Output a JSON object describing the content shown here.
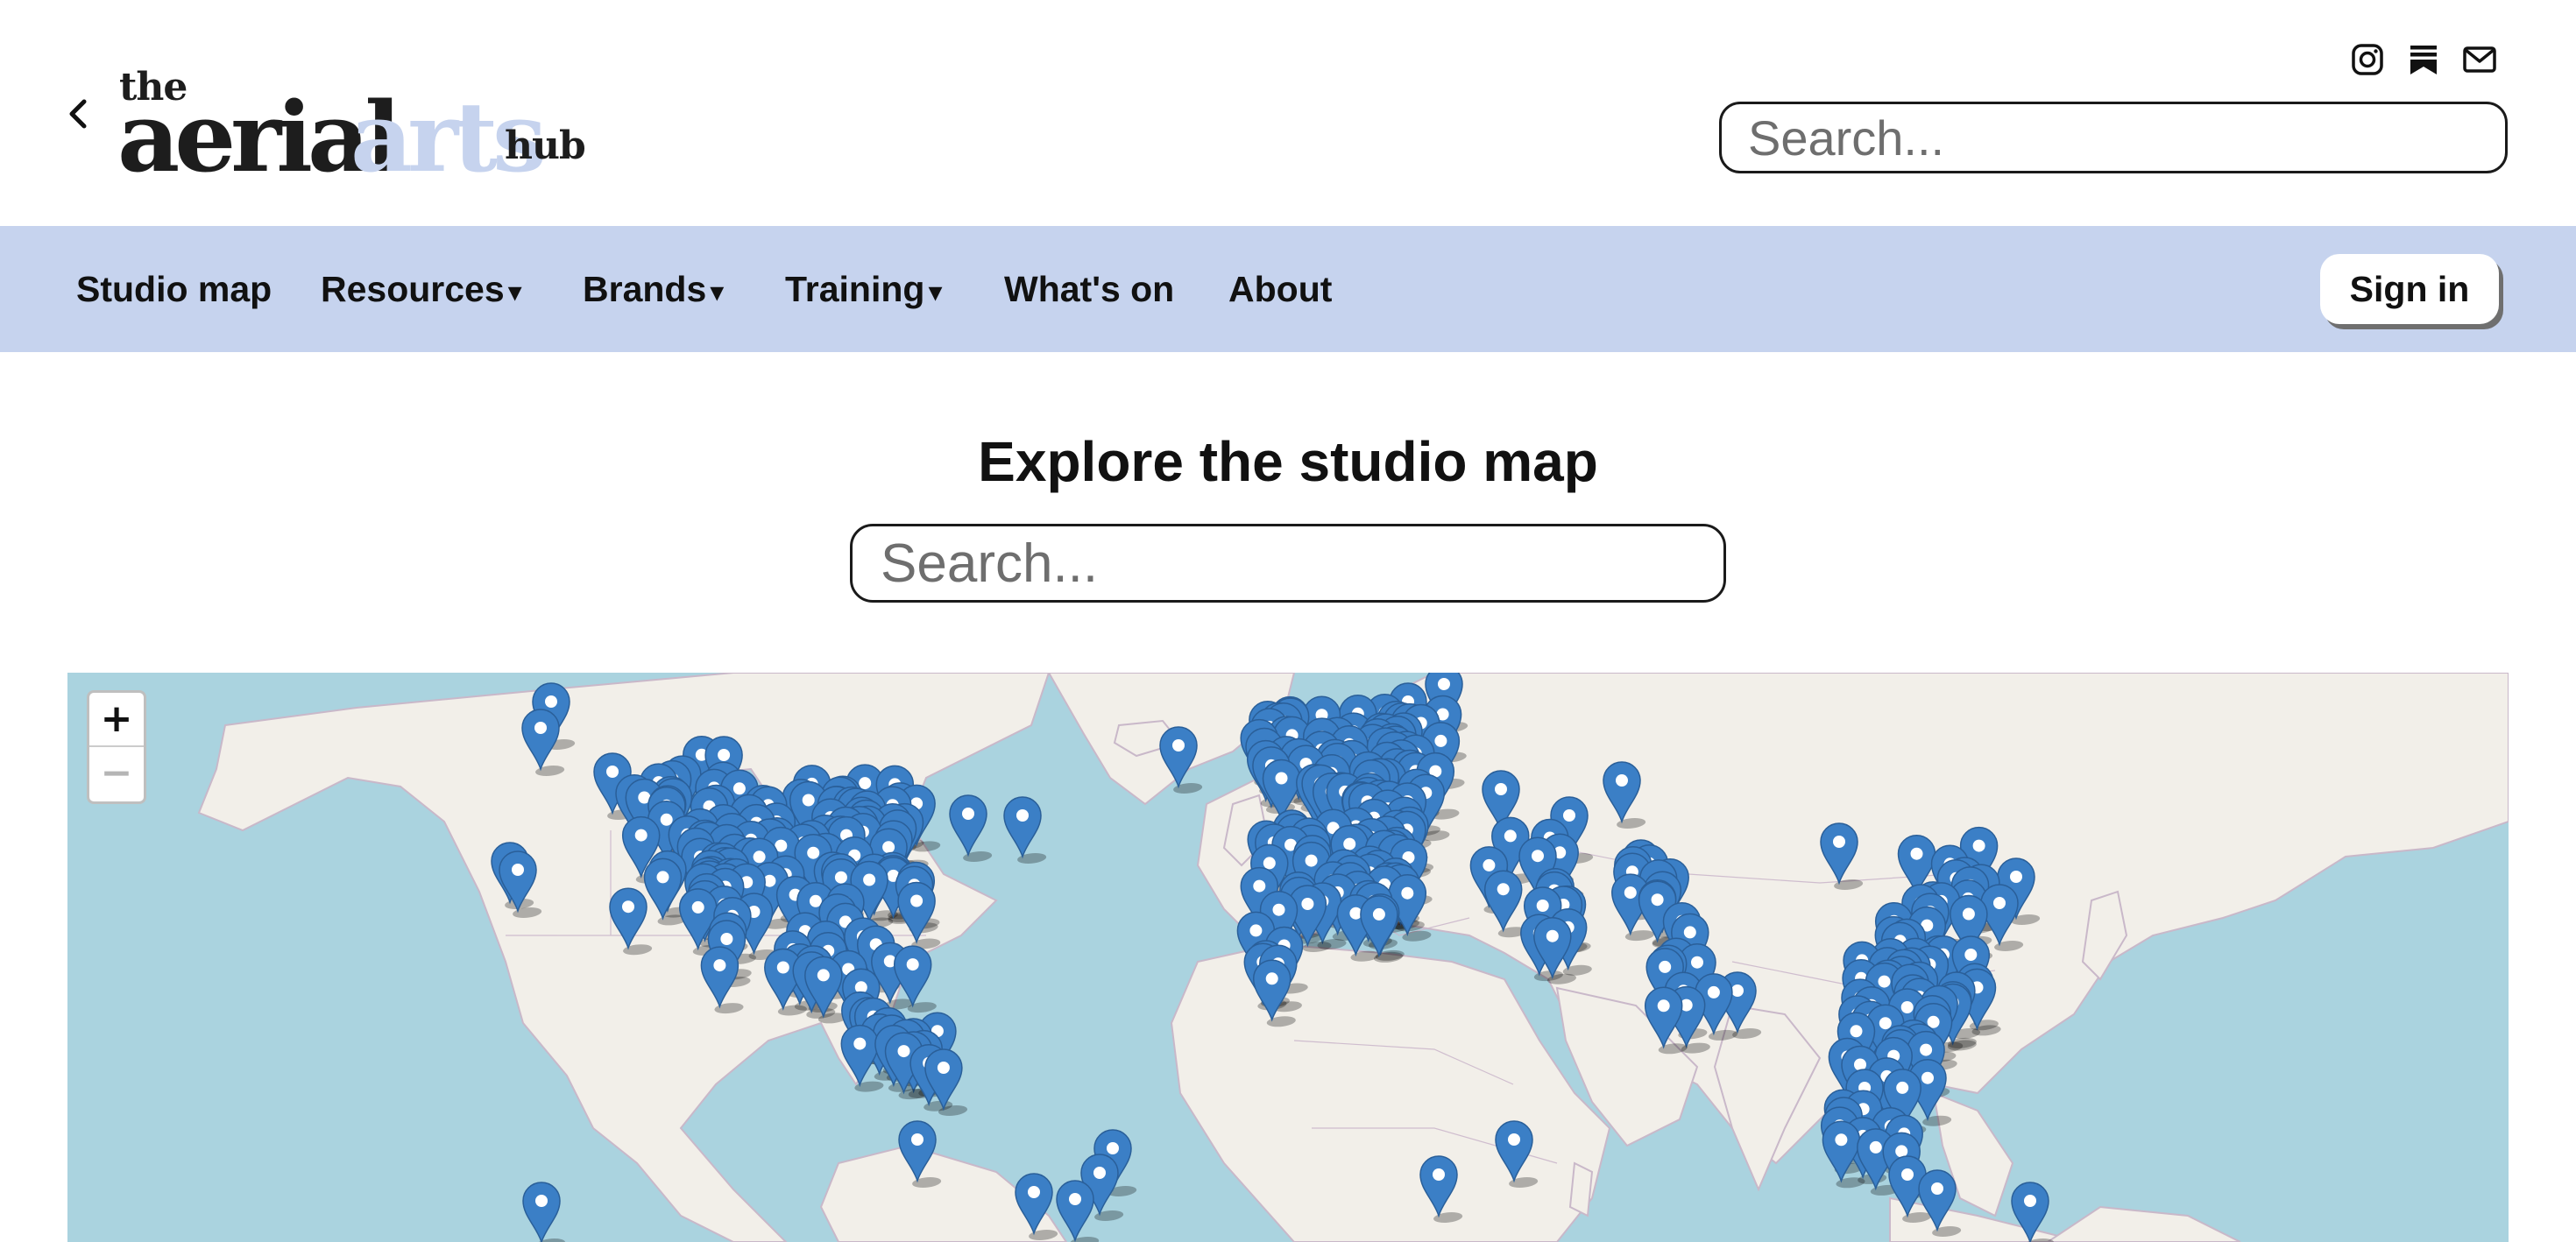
{
  "header": {
    "logo": {
      "the": "the",
      "aerial": "aerial",
      "arts": "arts",
      "hub": "hub"
    },
    "search": {
      "placeholder": "Search..."
    },
    "icons": [
      "chevron-left-icon",
      "instagram-icon",
      "substack-icon",
      "mail-icon"
    ]
  },
  "nav": {
    "items": [
      {
        "label": "Studio map",
        "dropdown": false
      },
      {
        "label": "Resources",
        "dropdown": true
      },
      {
        "label": "Brands",
        "dropdown": true
      },
      {
        "label": "Training",
        "dropdown": true
      },
      {
        "label": "What's on",
        "dropdown": false
      },
      {
        "label": "About",
        "dropdown": false
      }
    ],
    "caret": "▾",
    "signin_label": "Sign in"
  },
  "main": {
    "title": "Explore the studio map",
    "search": {
      "placeholder": "Search..."
    }
  },
  "map": {
    "zoom_in_label": "+",
    "zoom_out_label": "−",
    "marker_icon": "map-pin-icon"
  },
  "colors": {
    "nav_bg": "#c6d3ee",
    "logo_accent": "#c6d3ee",
    "ocean": "#aad3df",
    "land": "#f2efe9",
    "marker": "#3b7fc6"
  }
}
